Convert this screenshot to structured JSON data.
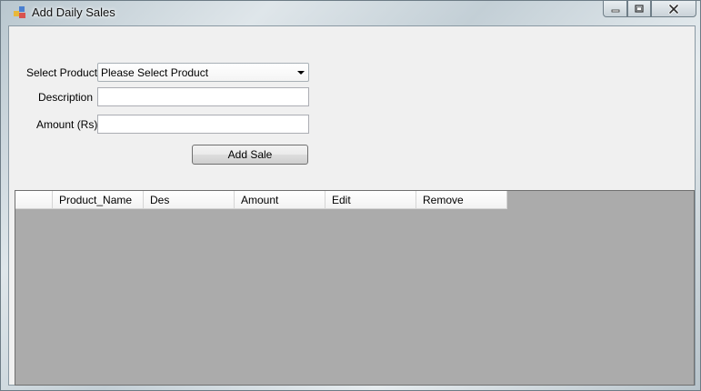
{
  "window": {
    "title": "Add Daily Sales"
  },
  "form": {
    "product_label": "Select Product",
    "product_selected": "Please Select Product",
    "description_label": "Description",
    "description_value": "",
    "amount_label": "Amount (Rs)",
    "amount_value": "",
    "add_button_label": "Add Sale"
  },
  "grid": {
    "columns": [
      "Product_Name",
      "Des",
      "Amount",
      "Edit",
      "Remove"
    ],
    "rows": [],
    "background_color": "#ababab"
  },
  "icons": {
    "app": "form-window-icon",
    "minimize": "minimize-icon",
    "maximize": "maximize-icon",
    "close": "close-icon",
    "dropdown": "chevron-down-icon"
  }
}
